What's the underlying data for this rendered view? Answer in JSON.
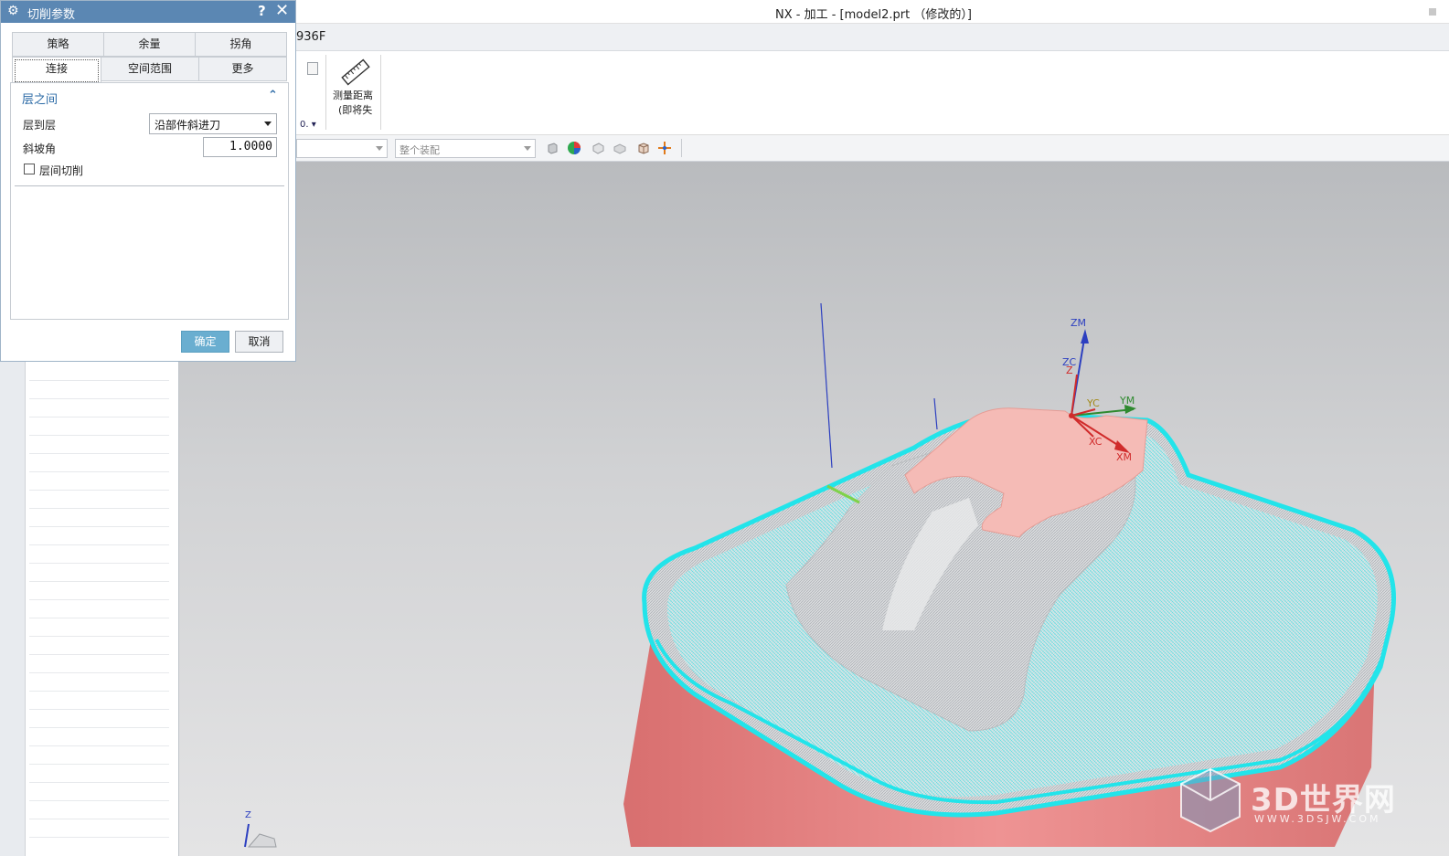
{
  "window": {
    "title": "NX - 加工 - [model2.prt （修改的）]"
  },
  "ribbon": {
    "tab_fragment": "936F",
    "dropdown_fragment": "0.",
    "measure_label_line1": "测量距离",
    "measure_label_line2": "(即将失"
  },
  "selection_bar": {
    "filter_placeholder": "",
    "scope_value": "整个装配"
  },
  "dialog": {
    "title": "切削参数",
    "help": "?",
    "close": "✕",
    "tabs_row1": [
      "策略",
      "余量",
      "拐角"
    ],
    "tabs_row2": [
      "连接",
      "空间范围",
      "更多"
    ],
    "active_tab": "连接",
    "group_title": "层之间",
    "layer_to_layer_label": "层到层",
    "layer_to_layer_value": "沿部件斜进刀",
    "ramp_angle_label": "斜坡角",
    "ramp_angle_value": "1.0000",
    "interlayer_cut_label": "层间切削",
    "interlayer_cut_checked": false,
    "ok_label": "确定",
    "cancel_label": "取消"
  },
  "viewport": {
    "csys_labels": {
      "zm": "ZM",
      "zc": "ZC",
      "z": "Z",
      "yc": "YC",
      "ym": "YM",
      "xc": "XC",
      "xm": "XM"
    },
    "triad_z": "Z"
  },
  "watermark": {
    "text": "3D世界网",
    "sub": "WWW.3DSJW.COM"
  },
  "colors": {
    "dialog_title_bg": "#5b87b3",
    "ok_button": "#6aaed0",
    "toolpath": "#3ee8ee",
    "part_red": "#e98a8a",
    "part_top": "#f5b9b5"
  }
}
